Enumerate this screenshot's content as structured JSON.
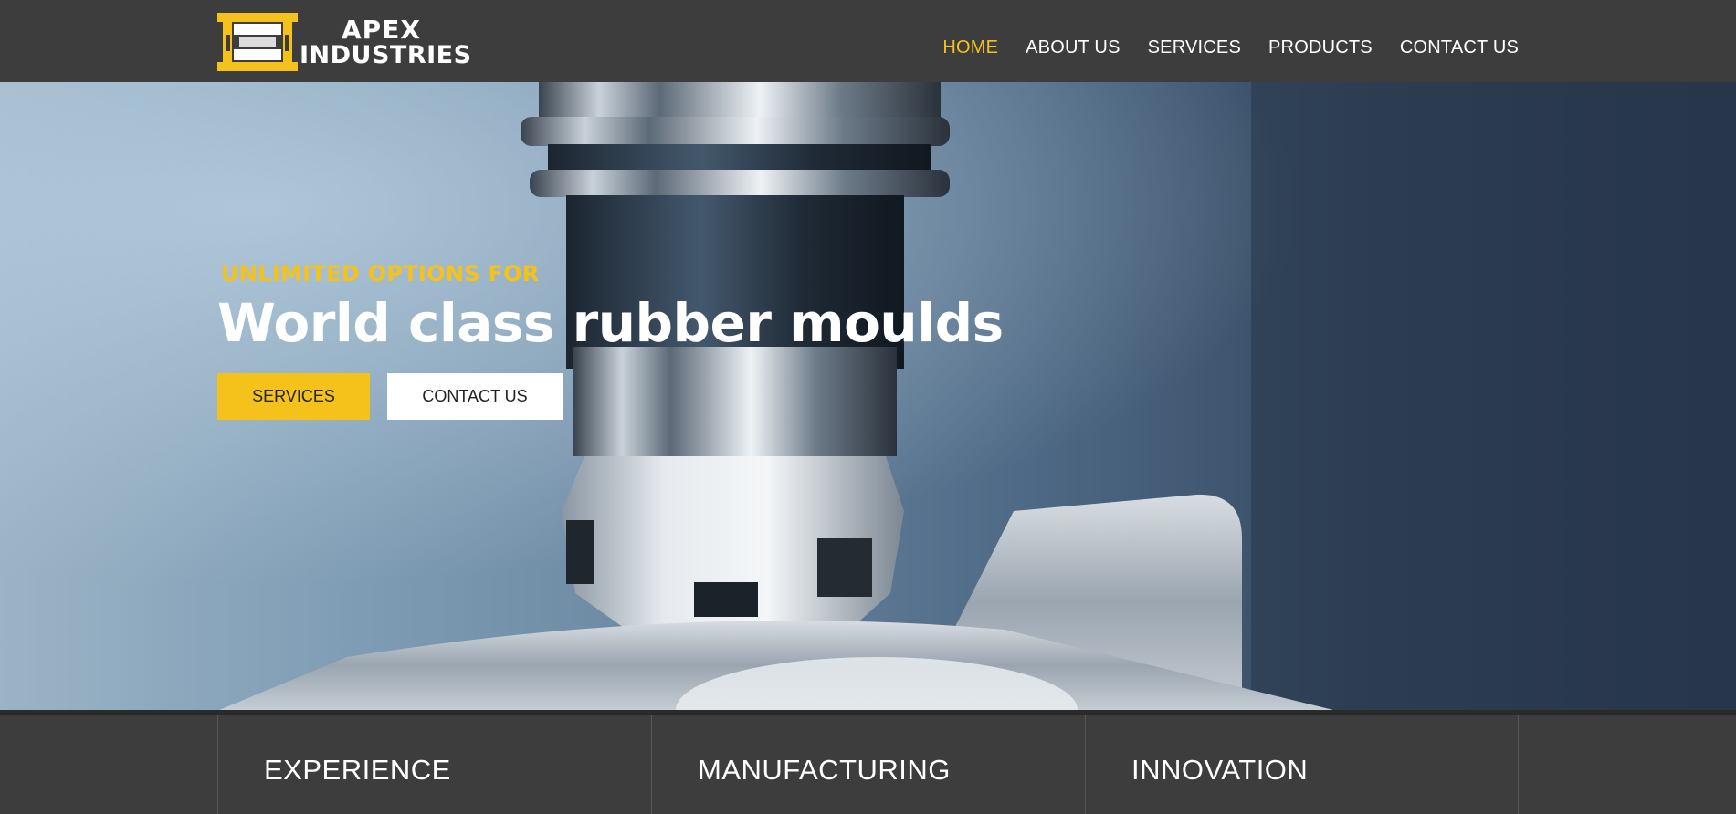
{
  "brand": {
    "line1": "APEX",
    "line2": "INDUSTRIES",
    "accent_color": "#f5c21b",
    "header_bg": "#3d3d3d",
    "logo_icon": "mould-press-icon"
  },
  "nav": {
    "items": [
      {
        "label": "HOME",
        "active": true
      },
      {
        "label": "ABOUT US",
        "active": false
      },
      {
        "label": "SERVICES",
        "active": false
      },
      {
        "label": "PRODUCTS",
        "active": false
      },
      {
        "label": "CONTACT US",
        "active": false
      }
    ]
  },
  "hero": {
    "subtitle": "UNLIMITED OPTIONS FOR",
    "title": "World class rubber moulds",
    "buttons": {
      "services": "SERVICES",
      "contact": "CONTACT US"
    },
    "image": "cnc-milling-cutter-photo"
  },
  "features": [
    {
      "title": "EXPERIENCE"
    },
    {
      "title": "MANUFACTURING"
    },
    {
      "title": "INNOVATION"
    }
  ]
}
